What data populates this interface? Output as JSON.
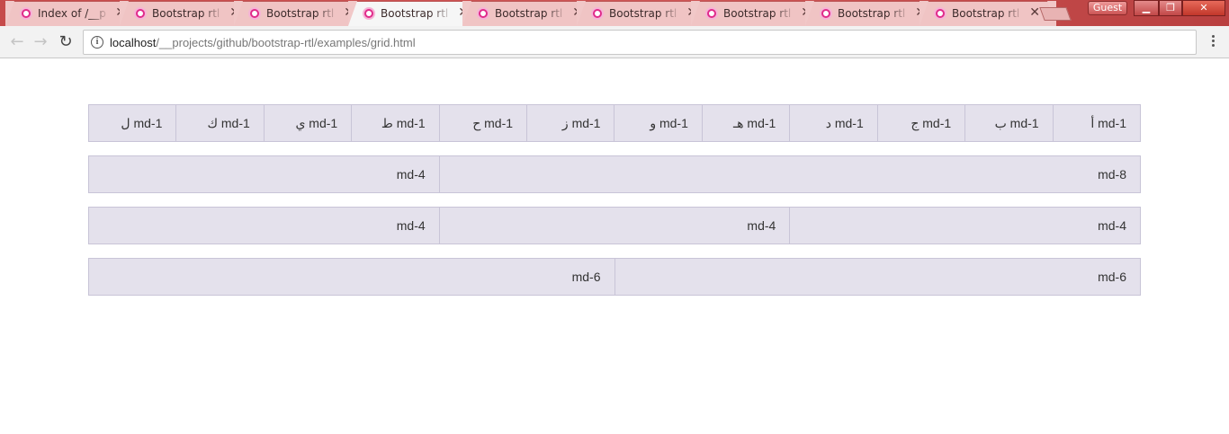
{
  "browser": {
    "tabs": [
      {
        "title": "Index of /__p",
        "active": false
      },
      {
        "title": "Bootstrap rtl",
        "active": false
      },
      {
        "title": "Bootstrap rtl",
        "active": false
      },
      {
        "title": "Bootstrap rtl",
        "active": true
      },
      {
        "title": "Bootstrap rtl",
        "active": false
      },
      {
        "title": "Bootstrap rtl",
        "active": false
      },
      {
        "title": "Bootstrap rtl",
        "active": false
      },
      {
        "title": "Bootstrap rtl",
        "active": false
      },
      {
        "title": "Bootstrap rtl",
        "active": false
      }
    ],
    "close_glyph": "✕",
    "profile_label": "Guest",
    "window_buttons": {
      "minimize": "▁",
      "maximize": "❐",
      "close": "✕"
    },
    "nav": {
      "back": "←",
      "forward": "→",
      "reload": "↻"
    },
    "address": {
      "host": "localhost",
      "path": "/__projects/github/bootstrap-rtl/examples/grid.html",
      "info_glyph": "i"
    }
  },
  "grid": {
    "rows": [
      {
        "cols": [
          {
            "label": "md-1 أ",
            "span": 1
          },
          {
            "label": "md-1 ب",
            "span": 1
          },
          {
            "label": "md-1 ج",
            "span": 1
          },
          {
            "label": "md-1 د",
            "span": 1
          },
          {
            "label": "md-1 هـ",
            "span": 1
          },
          {
            "label": "md-1 و",
            "span": 1
          },
          {
            "label": "md-1 ز",
            "span": 1
          },
          {
            "label": "md-1 ح",
            "span": 1
          },
          {
            "label": "md-1 ط",
            "span": 1
          },
          {
            "label": "md-1 ي",
            "span": 1
          },
          {
            "label": "md-1 ك",
            "span": 1
          },
          {
            "label": "md-1 ل",
            "span": 1
          }
        ]
      },
      {
        "cols": [
          {
            "label": "md-8",
            "span": 8
          },
          {
            "label": "md-4",
            "span": 4
          }
        ]
      },
      {
        "cols": [
          {
            "label": "md-4",
            "span": 4
          },
          {
            "label": "md-4",
            "span": 4
          },
          {
            "label": "md-4",
            "span": 4
          }
        ]
      },
      {
        "cols": [
          {
            "label": "md-6",
            "span": 6
          },
          {
            "label": "md-6",
            "span": 6
          }
        ]
      }
    ]
  }
}
